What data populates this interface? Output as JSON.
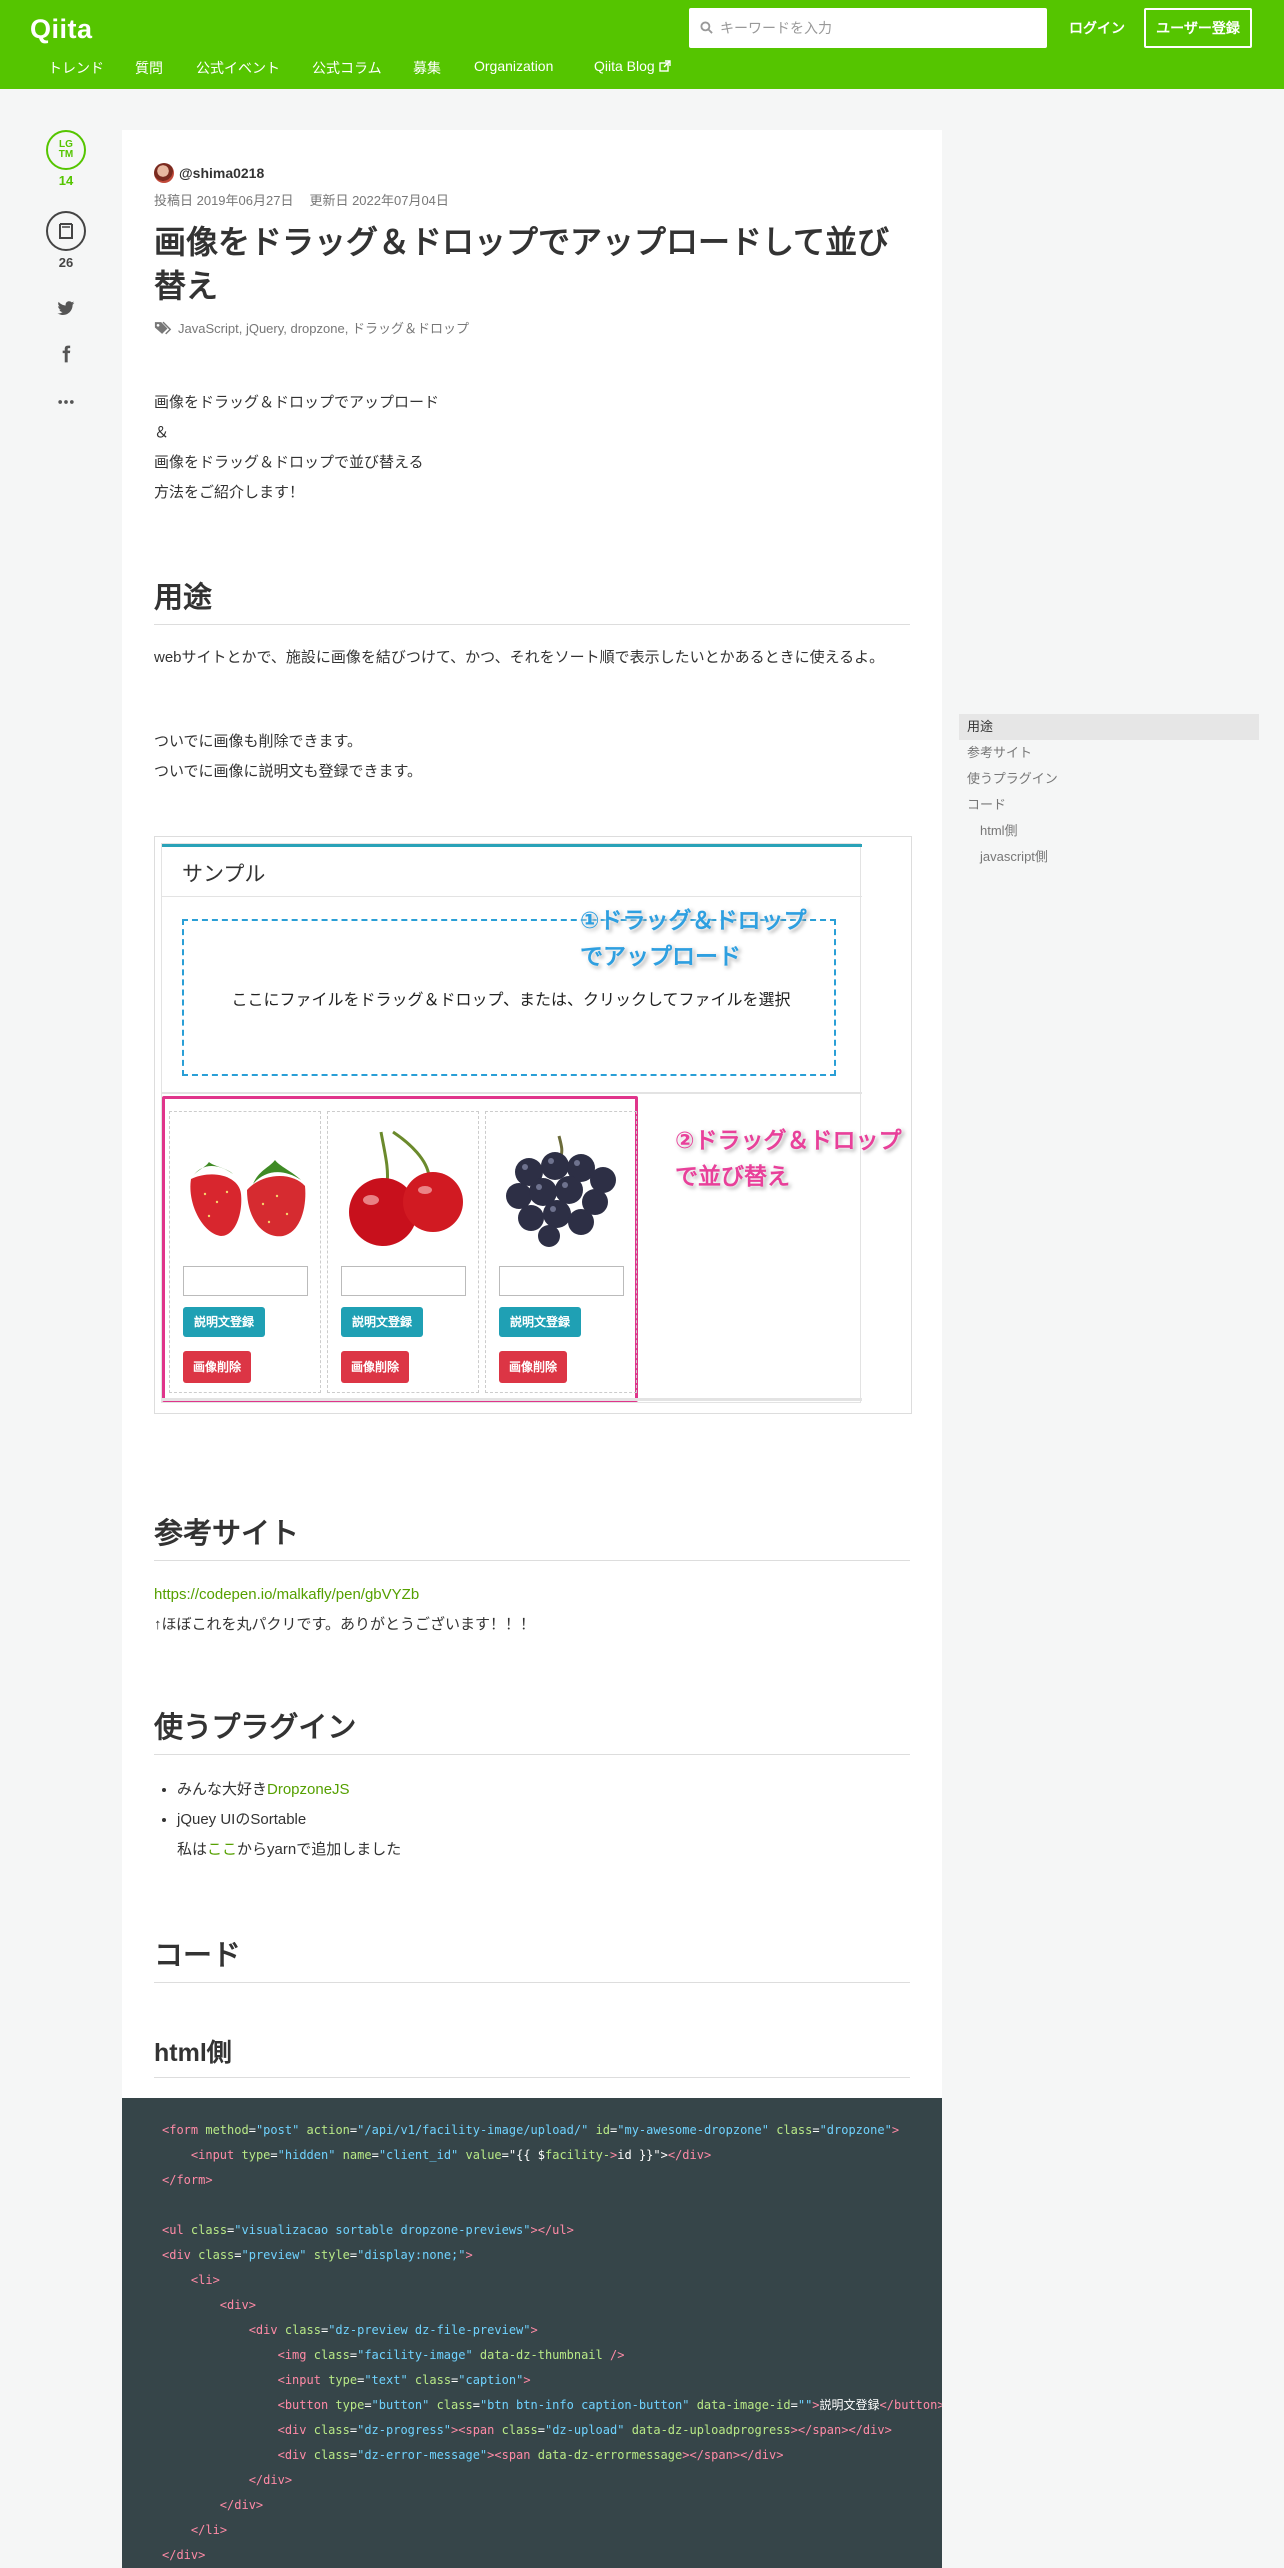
{
  "header": {
    "logo": "Qiita",
    "search_placeholder": "キーワードを入力",
    "login": "ログイン",
    "signup": "ユーザー登録",
    "nav": [
      "トレンド",
      "質問",
      "公式イベント",
      "公式コラム",
      "募集",
      "Organization",
      "Qiita Blog"
    ],
    "brand_color": "#55c500"
  },
  "sidebar": {
    "lgtm_label_1": "LG",
    "lgtm_label_2": "TM",
    "lgtm_count": "14",
    "stock_count": "26",
    "icons": [
      "lgtm-icon",
      "stock-icon",
      "twitter-icon",
      "facebook-icon",
      "more-icon"
    ]
  },
  "article": {
    "author": "@shima0218",
    "posted": "投稿日 2019年06月27日",
    "updated": "更新日 2022年07月04日",
    "title": "画像をドラッグ＆ドロップでアップロードして並び替え",
    "tags": [
      "JavaScript",
      "jQuery",
      "dropzone",
      "ドラッグ＆ドロップ"
    ],
    "intro": [
      "画像をドラッグ＆ドロップでアップロード",
      "＆",
      "画像をドラッグ＆ドロップで並び替える",
      "方法をご紹介します！"
    ],
    "sections": {
      "usage": {
        "heading": "用途",
        "p1": "webサイトとかで、施設に画像を結びつけて、かつ、それをソート順で表示したいとかあるときに使えるよ。",
        "p2a": "ついでに画像も削除できます。",
        "p2b": "ついでに画像に説明文も登録できます。"
      },
      "reference": {
        "heading": "参考サイト",
        "link": "https://codepen.io/malkafly/pen/gbVYZb",
        "note": "↑ほぼこれを丸パクリです。ありがとうございます！！！"
      },
      "plugins": {
        "heading": "使うプラグイン",
        "item1_prefix": "みんな大好き",
        "item1_link": "DropzoneJS",
        "item2": "jQuey UIのSortable",
        "item2_sub_prefix": "私は",
        "item2_sub_link": "ここ",
        "item2_sub_suffix": "からyarnで追加しました"
      },
      "code": {
        "heading": "コード",
        "html_heading": "html側"
      }
    },
    "figure": {
      "title": "サンプル",
      "dropzone_text": "ここにファイルをドラッグ＆ドロップ、または、クリックしてファイルを選択",
      "callout1_line1": "①ドラッグ＆ドロップ",
      "callout1_line2": "でアップロード",
      "callout2_line1": "②ドラッグ＆ドロップ",
      "callout2_line2": "で並び替え",
      "cards": [
        {
          "image": "strawberry",
          "info_btn": "説明文登録",
          "delete_btn": "画像削除"
        },
        {
          "image": "cherry",
          "info_btn": "説明文登録",
          "delete_btn": "画像削除"
        },
        {
          "image": "grape",
          "info_btn": "説明文登録",
          "delete_btn": "画像削除"
        }
      ]
    }
  },
  "toc": [
    {
      "label": "用途",
      "active": true,
      "level": 1
    },
    {
      "label": "参考サイト",
      "active": false,
      "level": 1
    },
    {
      "label": "使うプラグイン",
      "active": false,
      "level": 1
    },
    {
      "label": "コード",
      "active": false,
      "level": 1
    },
    {
      "label": "html側",
      "active": false,
      "level": 2
    },
    {
      "label": "javascript側",
      "active": false,
      "level": 2
    }
  ],
  "code_lines": [
    "<form method=\"post\" action=\"/api/v1/facility-image/upload/\" id=\"my-awesome-dropzone\" class=\"dropzone\">",
    "    <input type=\"hidden\" name=\"client_id\" value=\"{{ $facility->id }}\"></div>",
    "</form>",
    "",
    "<ul class=\"visualizacao sortable dropzone-previews\"></ul>",
    "<div class=\"preview\" style=\"display:none;\">",
    "    <li>",
    "        <div>",
    "            <div class=\"dz-preview dz-file-preview\">",
    "                <img class=\"facility-image\" data-dz-thumbnail />",
    "                <input type=\"text\" class=\"caption\">",
    "                <button type=\"button\" class=\"btn btn-info caption-button\" data-image-id=\"\">説明文登録</button>",
    "                <div class=\"dz-progress\"><span class=\"dz-upload\" data-dz-uploadprogress></span></div>",
    "                <div class=\"dz-error-message\"><span data-dz-errormessage></span></div>",
    "            </div>",
    "        </div>",
    "    </li>",
    "</div>"
  ]
}
